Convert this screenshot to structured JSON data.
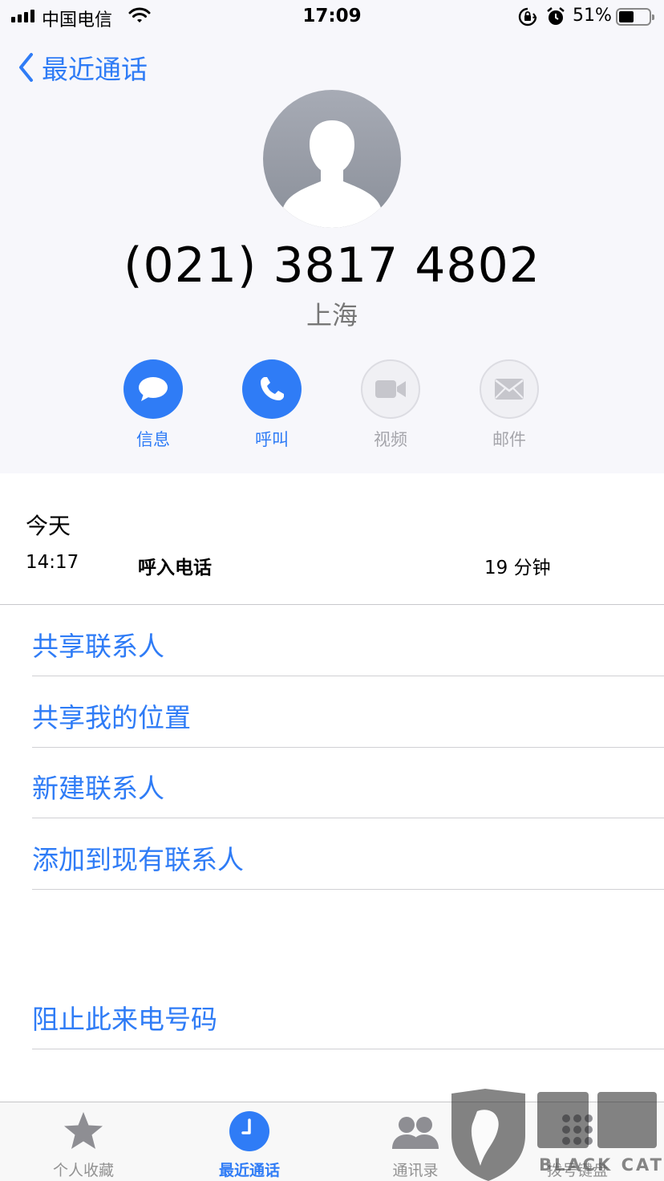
{
  "status_bar": {
    "carrier": "中国电信",
    "time": "17:09",
    "battery_percent": "51%",
    "battery_level": 0.51
  },
  "nav": {
    "back_label": "最近通话"
  },
  "contact": {
    "number": "(021) 3817 4802",
    "location": "上海"
  },
  "actions": [
    {
      "label": "信息",
      "icon": "message-icon",
      "enabled": true
    },
    {
      "label": "呼叫",
      "icon": "phone-icon",
      "enabled": true
    },
    {
      "label": "视频",
      "icon": "video-icon",
      "enabled": false
    },
    {
      "label": "邮件",
      "icon": "mail-icon",
      "enabled": false
    }
  ],
  "recent": {
    "title": "今天",
    "time": "14:17",
    "type": "呼入电话",
    "duration": "19 分钟"
  },
  "options": [
    "共享联系人",
    "共享我的位置",
    "新建联系人",
    "添加到现有联系人"
  ],
  "block_option": "阻止此来电号码",
  "tabbar": {
    "tabs": [
      "个人收藏",
      "最近通话",
      "通讯录",
      "拨号键盘"
    ],
    "active": "最近通话"
  },
  "watermark": {
    "text": "BLACK CAT"
  },
  "colors": {
    "accent": "#2f7cf6",
    "disabled": "#a5a5ab",
    "top_background": "#f7f7fb"
  }
}
